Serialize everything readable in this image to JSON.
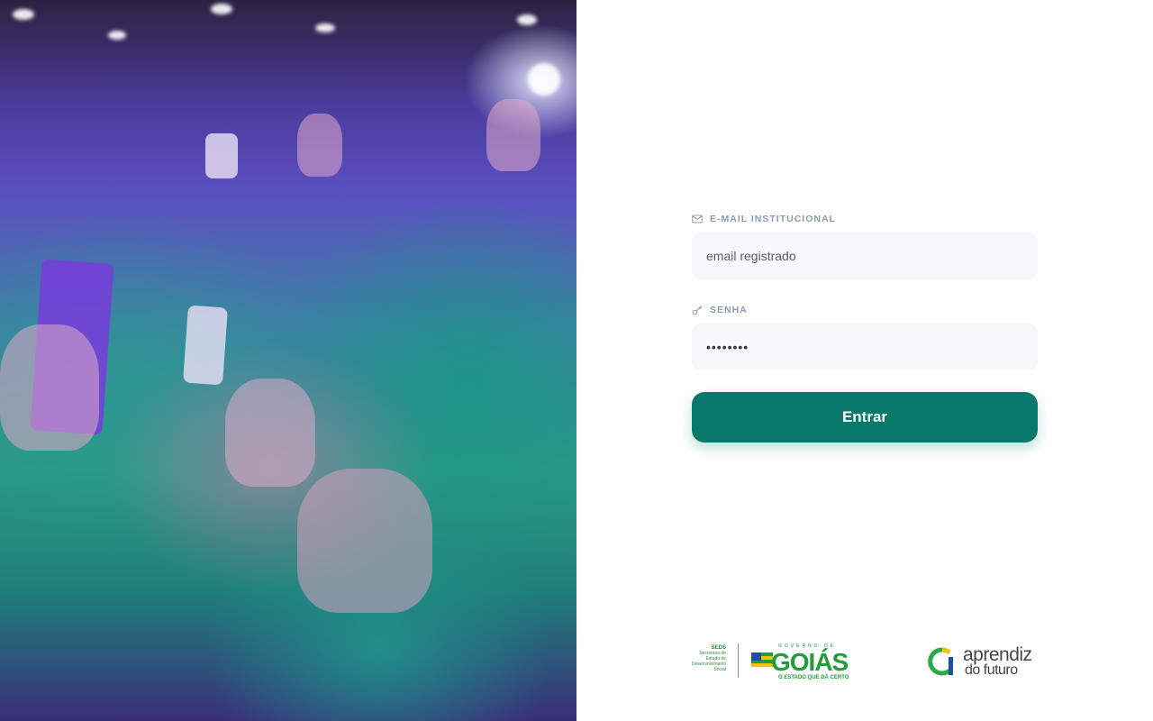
{
  "login": {
    "email_label": "E-MAIL INSTITUCIONAL",
    "email_placeholder": "email registrado",
    "password_label": "SENHA",
    "password_value": "••••••••",
    "submit_label": "Entrar"
  },
  "footer": {
    "seds_title": "SEDS",
    "seds_subtitle": "Secretaria de Estado de Desenvolvimento Social",
    "goias_top": "GOVERNO DE",
    "goias_name": "GOIÁS",
    "goias_tagline": "O ESTADO QUE DÁ CERTO",
    "af_line1": "aprendiz",
    "af_line2": "do futuro"
  },
  "colors": {
    "primary": "#08786b",
    "label": "#8a9bb0",
    "field_bg": "#f6f8fa"
  },
  "icons": {
    "email": "mail-icon",
    "password": "key-icon"
  }
}
